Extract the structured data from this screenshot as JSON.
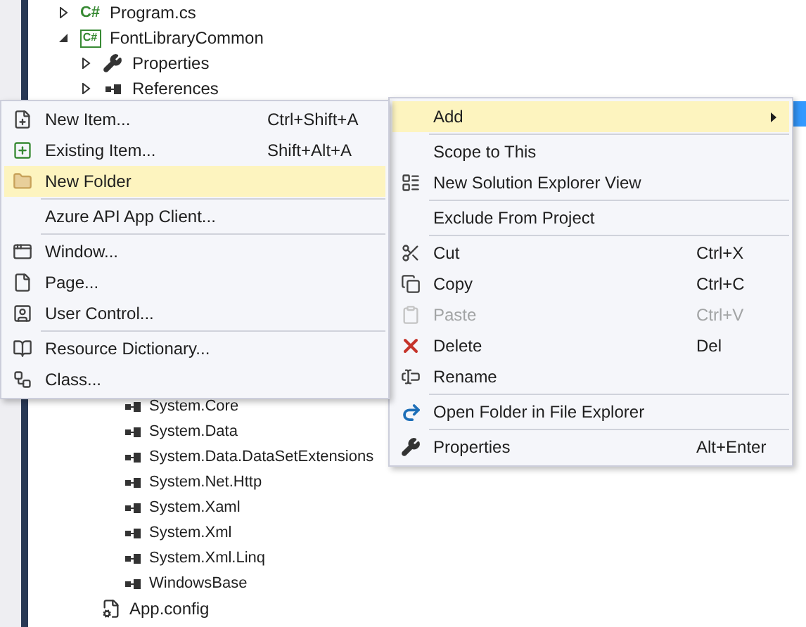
{
  "tree_top": [
    {
      "label": "Program.cs",
      "kind": "csharp-file",
      "icon_text": "C#",
      "expanded": false,
      "selected": false
    },
    {
      "label": "FontLibraryCommon",
      "kind": "project",
      "icon_text": "C#",
      "expanded": true,
      "selected": false,
      "children": [
        {
          "label": "Properties",
          "kind": "properties",
          "expanded": false,
          "selected": false
        },
        {
          "label": "References",
          "kind": "references",
          "expanded": false,
          "selected": false
        },
        {
          "kind": "folder",
          "selected": true
        }
      ]
    }
  ],
  "reference_items": [
    "System.Core",
    "System.Data",
    "System.Data.DataSetExtensions",
    "System.Net.Http",
    "System.Xaml",
    "System.Xml",
    "System.Xml.Linq",
    "WindowsBase"
  ],
  "file_items": [
    "App.config"
  ],
  "add_submenu": [
    {
      "label": "New Item...",
      "shortcut": "Ctrl+Shift+A",
      "selected": false,
      "separator_before": false
    },
    {
      "label": "Existing Item...",
      "shortcut": "Shift+Alt+A",
      "selected": false,
      "separator_before": false
    },
    {
      "label": "New Folder",
      "selected": true,
      "separator_before": false
    },
    {
      "label": "Azure API App Client...",
      "selected": false,
      "separator_before": true
    },
    {
      "label": "Window...",
      "selected": false,
      "separator_before": true
    },
    {
      "label": "Page...",
      "selected": false,
      "separator_before": false
    },
    {
      "label": "User Control...",
      "selected": false,
      "separator_before": false
    },
    {
      "label": "Resource Dictionary...",
      "selected": false,
      "separator_before": true
    },
    {
      "label": "Class...",
      "selected": false,
      "separator_before": false
    }
  ],
  "context_menu": [
    {
      "label": "Add",
      "selected": true,
      "has_submenu": true,
      "disabled": false,
      "separator_before": false
    },
    {
      "label": "Scope to This",
      "selected": false,
      "has_submenu": false,
      "disabled": false,
      "separator_before": true
    },
    {
      "label": "New Solution Explorer View",
      "selected": false,
      "has_submenu": false,
      "disabled": false,
      "separator_before": false
    },
    {
      "label": "Exclude From Project",
      "selected": false,
      "has_submenu": false,
      "disabled": false,
      "separator_before": true
    },
    {
      "label": "Cut",
      "shortcut": "Ctrl+X",
      "selected": false,
      "has_submenu": false,
      "disabled": false,
      "separator_before": true
    },
    {
      "label": "Copy",
      "shortcut": "Ctrl+C",
      "selected": false,
      "has_submenu": false,
      "disabled": false,
      "separator_before": false
    },
    {
      "label": "Paste",
      "shortcut": "Ctrl+V",
      "selected": false,
      "has_submenu": false,
      "disabled": true,
      "separator_before": false
    },
    {
      "label": "Delete",
      "shortcut": "Del",
      "selected": false,
      "has_submenu": false,
      "disabled": false,
      "separator_before": false
    },
    {
      "label": "Rename",
      "selected": false,
      "has_submenu": false,
      "disabled": false,
      "separator_before": false
    },
    {
      "label": "Open Folder in File Explorer",
      "selected": false,
      "has_submenu": false,
      "disabled": false,
      "separator_before": true
    },
    {
      "label": "Properties",
      "shortcut": "Alt+Enter",
      "selected": false,
      "has_submenu": false,
      "disabled": false,
      "separator_before": true
    }
  ]
}
